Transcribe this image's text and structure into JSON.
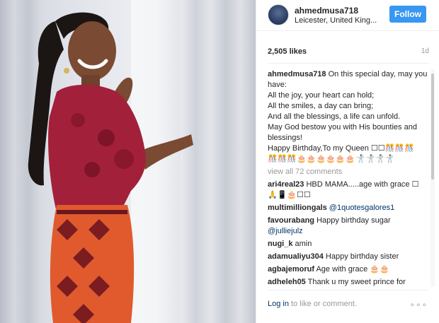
{
  "post": {
    "username": "ahmedmusa718",
    "location": "Leicester, United King...",
    "follow_label": "Follow",
    "likes": "2,505 likes",
    "time": "1d",
    "caption_user": "ahmedmusa718",
    "caption_text": " On this special day, may you have:\nAll the joy, your heart can hold;\nAll the smiles, a day can bring;\nAnd all the blessings, a life can unfold.\nMay God bestow you with His bounties and blessings!\nHappy Birthday,To my Queen ☐☐🎊🎊🎊\n🎊🎊🎊🎂🎂🎂🎂🎂🎂🤺🤺🤺🤺",
    "view_all": "view all 72 comments",
    "comments": [
      {
        "user": "ari4real23",
        "text": " HBD MAMA.....age with grace ☐\n🙏📱🎂☐☐",
        "mention": ""
      },
      {
        "user": "multimilliongals",
        "text": " ",
        "mention": "@1quotesgalores1"
      },
      {
        "user": "favourabang",
        "text": " Happy birthday sugar ",
        "mention": "@julliejulz"
      },
      {
        "user": "nugi_k",
        "text": " amin",
        "mention": ""
      },
      {
        "user": "adamualiyu304",
        "text": " Happy birthday sister",
        "mention": ""
      },
      {
        "user": "agbajemoruf",
        "text": " Age with grace 🎂🎂",
        "mention": ""
      },
      {
        "user": "adheleh05",
        "text": " Thank u my sweet prince for",
        "mention": ""
      }
    ],
    "login_link": "Log in",
    "login_rest": " to like or comment.",
    "more_icon": "ellipsis-icon",
    "more_glyph": "∘∘∘"
  },
  "colors": {
    "follow_button": "#3897f0",
    "link": "#003569",
    "muted": "#999999",
    "dress_red": "#b0243a",
    "dress_orange": "#e05a2e"
  }
}
